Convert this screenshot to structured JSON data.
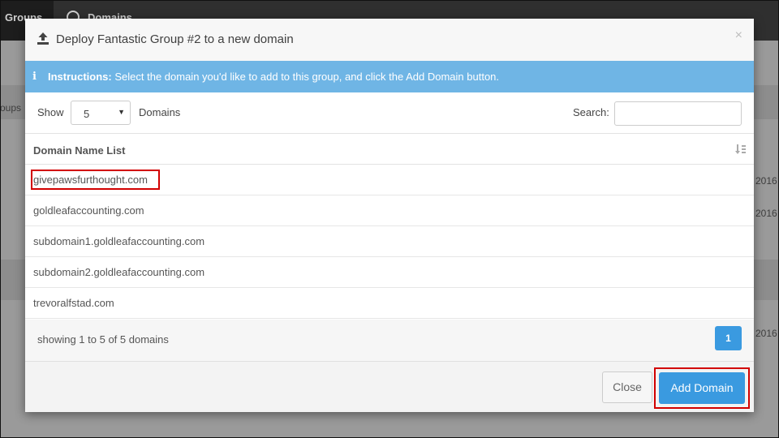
{
  "background": {
    "tabs": [
      "Groups",
      "Domains"
    ],
    "side_text_left": "oups",
    "side_text_right": [
      "2016",
      "2016",
      "2016"
    ]
  },
  "modal": {
    "title": "Deploy Fantastic Group #2 to a new domain",
    "close_symbol": "×",
    "instructions": {
      "icon": "i",
      "label": "Instructions:",
      "text": "Select the domain you'd like to add to this group, and click the Add Domain button."
    },
    "length_menu": {
      "show_label": "Show",
      "selected": "5",
      "suffix_label": "Domains"
    },
    "search": {
      "label": "Search:",
      "value": ""
    },
    "table": {
      "header": "Domain Name List",
      "rows": [
        "givepawsfurthought.com",
        "goldleafaccounting.com",
        "subdomain1.goldleafaccounting.com",
        "subdomain2.goldleafaccounting.com",
        "trevoralfstad.com"
      ]
    },
    "pagination": {
      "info": "showing 1 to 5 of 5 domains",
      "current_page": "1"
    },
    "buttons": {
      "close": "Close",
      "add": "Add Domain"
    }
  },
  "colors": {
    "primary": "#3a9ae0",
    "alert_bg": "#6fb5e5",
    "highlight": "#d20000"
  }
}
